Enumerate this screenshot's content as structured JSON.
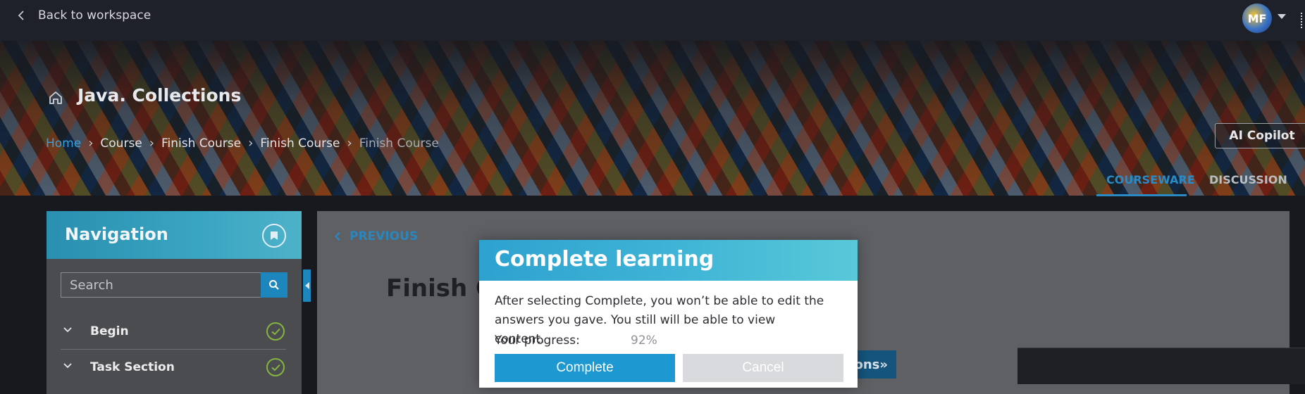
{
  "topbar": {
    "back_label": "Back to workspace",
    "avatar_initials": "MF"
  },
  "banner": {
    "course_title": "Java. Collections",
    "breadcrumb": [
      "Home",
      "Course",
      "Finish Course",
      "Finish Course",
      "Finish Course"
    ],
    "ai_copilot_label": "AI Copilot",
    "tabs": [
      {
        "label": "COURSEWARE",
        "active": true
      },
      {
        "label": "DISCUSSION",
        "active": false
      }
    ]
  },
  "sidebar": {
    "title": "Navigation",
    "search_placeholder": "Search",
    "items": [
      {
        "label": "Begin",
        "completed": true
      },
      {
        "label": "Task Section",
        "completed": true
      }
    ]
  },
  "content": {
    "previous_label": "PREVIOUS",
    "heading_partial": "Finish Co",
    "button_partial": "ions»"
  },
  "modal": {
    "title": "Complete learning",
    "body": "After selecting Complete, you won’t be able to edit the answers you gave. You still will be able to view content.",
    "progress_label": "Your progress:",
    "progress_value": "92%",
    "complete_label": "Complete",
    "cancel_label": "Cancel"
  },
  "colors": {
    "accent": "#1d98d1",
    "nav_header": "#3aa5c2",
    "check_green": "#86b53f",
    "background": "#17191f"
  },
  "icons": [
    "chevron-left-icon",
    "home-icon",
    "bookmark-icon",
    "search-icon",
    "chevron-down-icon",
    "check-circle-icon",
    "caret-down-icon",
    "kebab-menu-icon"
  ]
}
